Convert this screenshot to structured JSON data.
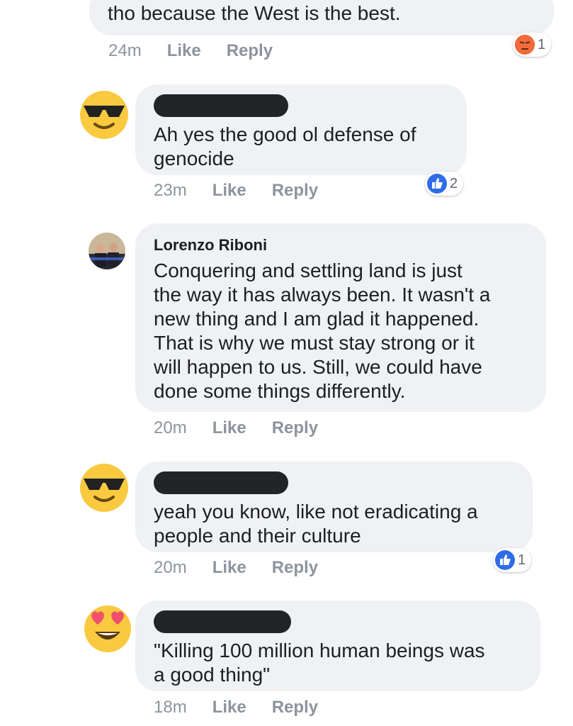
{
  "comments": [
    {
      "text": "tho because the West is the best.",
      "time": "24m",
      "like": "Like",
      "reply": "Reply",
      "reaction": {
        "type": "angry",
        "count": "1"
      }
    },
    {
      "avatar": "sunglasses-emoji",
      "text": "Ah yes the good ol defense of\ngenocide",
      "time": "23m",
      "like": "Like",
      "reply": "Reply",
      "reaction": {
        "type": "like",
        "count": "2"
      }
    },
    {
      "avatar": "profile-photo",
      "author": "Lorenzo Riboni",
      "text": "Conquering and settling land is just\nthe way it has always been. It wasn't a\nnew thing and I am glad it happened.\nThat is why we must stay strong or it\nwill happen to us. Still, we could have\ndone some things differently.",
      "time": "20m",
      "like": "Like",
      "reply": "Reply"
    },
    {
      "avatar": "sunglasses-emoji",
      "text": "yeah you know, like not eradicating a\npeople and their culture",
      "time": "20m",
      "like": "Like",
      "reply": "Reply",
      "reaction": {
        "type": "like",
        "count": "1"
      }
    },
    {
      "avatar": "heart-eyes-emoji",
      "text": "\"Killing 100 million human beings was\na good thing\"",
      "time": "18m",
      "like": "Like",
      "reply": "Reply"
    }
  ],
  "colors": {
    "like_blue": "#2f6ce8",
    "angry_orange": "#f0593a",
    "bubble": "#f0f1f4",
    "meta": "#8d949e"
  }
}
